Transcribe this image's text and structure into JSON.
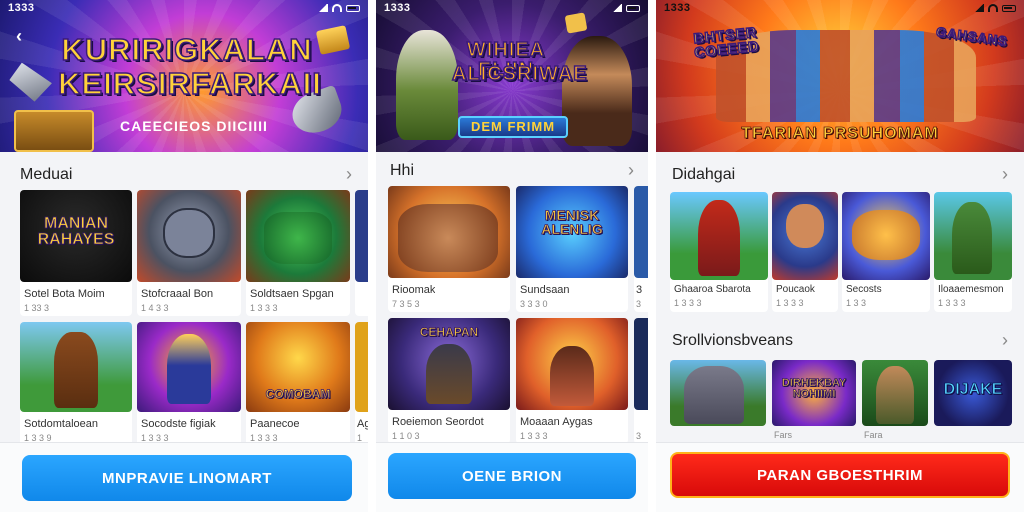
{
  "screens": [
    {
      "status_time": "1333",
      "banner_title_1": "KURIRIGKALAN",
      "banner_title_2": "KEIRSIRFARKAII",
      "banner_sub": "CAEECIEOS DIICIIII",
      "section_title": "Meduai",
      "tiles": [
        {
          "art": "MANIAN RAHAYES",
          "name": "Sotel Bota Moim",
          "meta": "1 33 3"
        },
        {
          "art": "",
          "name": "Stofcraaal Bon",
          "meta": "1 4 3 3"
        },
        {
          "art": "",
          "name": "Soldtsaen Spgan",
          "meta": "1 3 3 3"
        },
        {
          "art": "",
          "name": "",
          "meta": ""
        },
        {
          "art": "",
          "name": "Sotdomtaloean",
          "meta": "1 3 3 9"
        },
        {
          "art": "",
          "name": "Socodste figiak",
          "meta": "1 3 3 3"
        },
        {
          "art": "COMOBAM",
          "name": "Paanecoe",
          "meta": "1 3 3 3"
        },
        {
          "art": "",
          "name": "Ag",
          "meta": "1"
        }
      ],
      "cta": "MNPRAVIE LINOMART"
    },
    {
      "status_time": "1333",
      "banner_title_1": "WIHIEA ELIIN",
      "banner_title_2": "ALICSRIWAE",
      "banner_sub": "DEM FRIMM",
      "section_title": "Hhi",
      "tiles": [
        {
          "art": "",
          "name": "Rioomak",
          "meta": "7 3 5 3"
        },
        {
          "art": "MENISK ALENLIG",
          "name": "Sundsaan",
          "meta": "3 3 3 0"
        },
        {
          "art": "",
          "name": "3",
          "meta": "3"
        },
        {
          "art": "CEHAPAN",
          "name": "Roeiemon Seordot",
          "meta": "1 1 0 3"
        },
        {
          "art": "",
          "name": "Moaaan Aygas",
          "meta": "1 3 3 3"
        },
        {
          "art": "",
          "name": "",
          "meta": "3"
        }
      ],
      "cta": "OENE BRION"
    },
    {
      "status_time": "1333",
      "banner_title_1": "BHTSER COEEED",
      "banner_sub": "TFARIAN PRSUHOMAM",
      "banner_tag": "GAHSANS",
      "section_title": "Didahgai",
      "tiles": [
        {
          "art": "",
          "name": "Ghaaroa Sbarota",
          "meta": "1 3 3 3"
        },
        {
          "art": "",
          "name": "Poucaok",
          "meta": "1 3 3 3"
        },
        {
          "art": "",
          "name": "Secosts",
          "meta": "1 3 3"
        },
        {
          "art": "",
          "name": "Iloaaemesmon",
          "meta": "1 3 3 3"
        }
      ],
      "section2_title": "Srollvionsbveans",
      "row2": [
        {
          "art": ""
        },
        {
          "art": "DIRHEKBAY NOHIIMI"
        },
        {
          "art": ""
        },
        {
          "art": "DIJAKE"
        }
      ],
      "row2_meta": [
        "Fars",
        "Fara"
      ],
      "cta": "PARAN GBOESTHRIM"
    }
  ],
  "colors": {
    "cta_blue": "#1e98f5",
    "cta_red": "#e8120f",
    "banner_text": "#ffd23a"
  }
}
